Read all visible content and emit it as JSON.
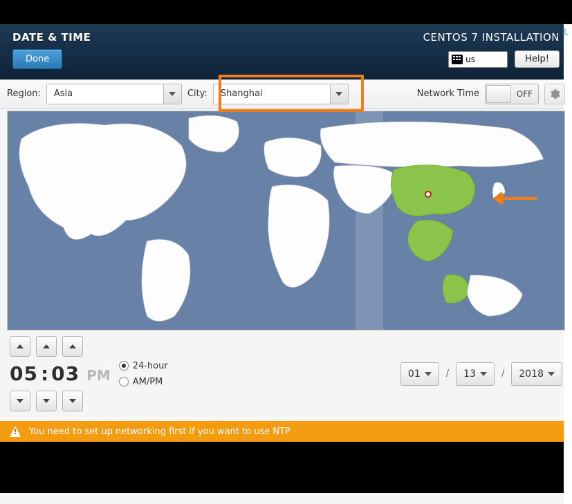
{
  "header": {
    "title": "DATE & TIME",
    "subtitle": "CENTOS 7 INSTALLATION",
    "done_label": "Done",
    "help_label": "Help!",
    "keyboard_layout": "us"
  },
  "controls": {
    "region_label": "Region:",
    "region_value": "Asia",
    "city_label": "City:",
    "city_value": "Shanghai",
    "network_time_label": "Network Time",
    "network_time_state": "OFF"
  },
  "time": {
    "hours": "05",
    "minutes": "03",
    "ampm": "PM",
    "format_24_label": "24-hour",
    "format_12_label": "AM/PM",
    "format_selected": "24-hour"
  },
  "date": {
    "month": "01",
    "day": "13",
    "year": "2018",
    "separator": "/"
  },
  "warning": {
    "text": "You need to set up networking first if you want to use NTP"
  },
  "colors": {
    "accent_green": "#8bc44a",
    "highlight_orange": "#f07c1a",
    "sea": "#6882a7",
    "warn_bg": "#f39c12"
  },
  "annotations": {
    "outer_right_text": "L"
  }
}
